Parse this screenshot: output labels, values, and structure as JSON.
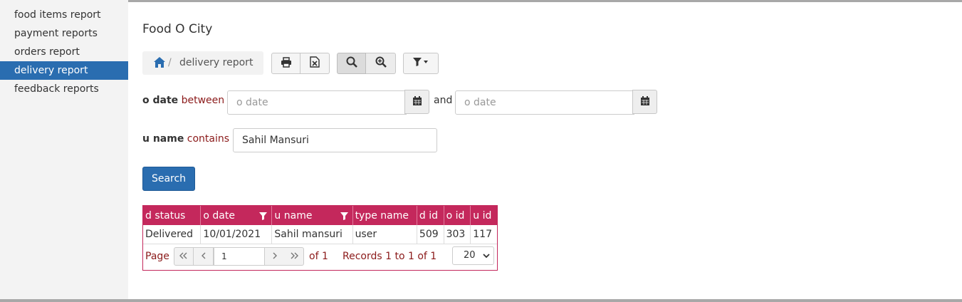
{
  "sidebar": {
    "items": [
      {
        "label": "food items report"
      },
      {
        "label": "payment reports"
      },
      {
        "label": "orders report"
      },
      {
        "label": "delivery report"
      },
      {
        "label": "feedback reports"
      }
    ],
    "active_index": 3
  },
  "header": {
    "title": "Food O City",
    "breadcrumb": {
      "separator": "/",
      "current": "delivery report"
    }
  },
  "toolbar": {
    "icons": [
      "print-icon",
      "excel-icon",
      "search-icon",
      "zoom-in-icon",
      "filter-icon"
    ]
  },
  "filters": {
    "o_date": {
      "field": "o date",
      "operator": "between",
      "placeholder_from": "o date",
      "conjunction": "and",
      "placeholder_to": "o date"
    },
    "u_name": {
      "field": "u name",
      "operator": "contains",
      "value": "Sahil Mansuri"
    }
  },
  "search_button": {
    "label": "Search"
  },
  "grid": {
    "columns": [
      "d status",
      "o date",
      "u name",
      "type name",
      "d id",
      "o id",
      "u id"
    ],
    "rows": [
      [
        "Delivered",
        "10/01/2021",
        "Sahil mansuri",
        "user",
        "509",
        "303",
        "117"
      ]
    ],
    "pager": {
      "page_label": "Page",
      "page_value": "1",
      "of_label": "of 1",
      "records": "Records 1 to 1 of 1",
      "page_size": "20"
    }
  },
  "colors": {
    "accent": "#2a6db0",
    "grid_header": "#c4285c",
    "operator_text": "#8b1a1a"
  }
}
